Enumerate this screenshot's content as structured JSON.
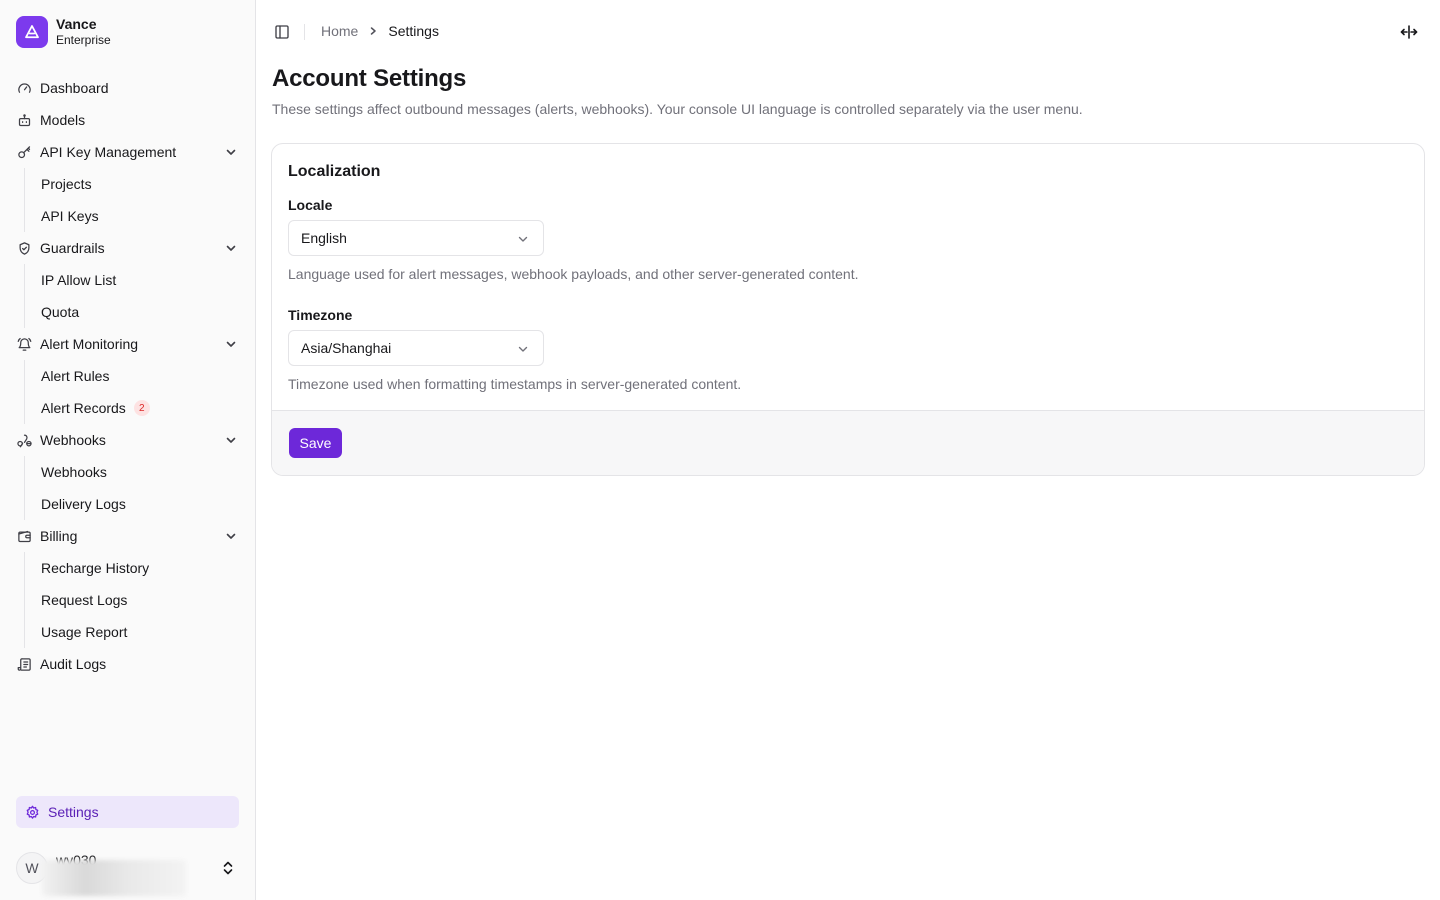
{
  "brand": {
    "name": "Vance",
    "subtitle": "Enterprise"
  },
  "sidebar": {
    "dashboard": "Dashboard",
    "models": "Models",
    "api_key_management": {
      "label": "API Key Management",
      "items": [
        "Projects",
        "API Keys"
      ]
    },
    "guardrails": {
      "label": "Guardrails",
      "items": [
        "IP Allow List",
        "Quota"
      ]
    },
    "alert_monitoring": {
      "label": "Alert Monitoring",
      "items": [
        "Alert Rules",
        "Alert Records"
      ],
      "alert_records_badge": "2"
    },
    "webhooks": {
      "label": "Webhooks",
      "items": [
        "Webhooks",
        "Delivery Logs"
      ]
    },
    "billing": {
      "label": "Billing",
      "items": [
        "Recharge History",
        "Request Logs",
        "Usage Report"
      ]
    },
    "audit_logs": "Audit Logs",
    "settings": "Settings"
  },
  "user": {
    "avatar_initial": "W",
    "name": "wy030"
  },
  "breadcrumb": {
    "home": "Home",
    "current": "Settings"
  },
  "page": {
    "title": "Account Settings",
    "description": "These settings affect outbound messages (alerts, webhooks). Your console UI language is controlled separately via the user menu."
  },
  "localization": {
    "title": "Localization",
    "locale": {
      "label": "Locale",
      "value": "English",
      "help": "Language used for alert messages, webhook payloads, and other server-generated content."
    },
    "timezone": {
      "label": "Timezone",
      "value": "Asia/Shanghai",
      "help": "Timezone used when formatting timestamps in server-generated content."
    },
    "save_label": "Save"
  },
  "colors": {
    "accent": "#6d28d9",
    "accent_light": "#ede7fb",
    "badge_bg": "#fde2e2",
    "badge_text": "#dc2626"
  }
}
